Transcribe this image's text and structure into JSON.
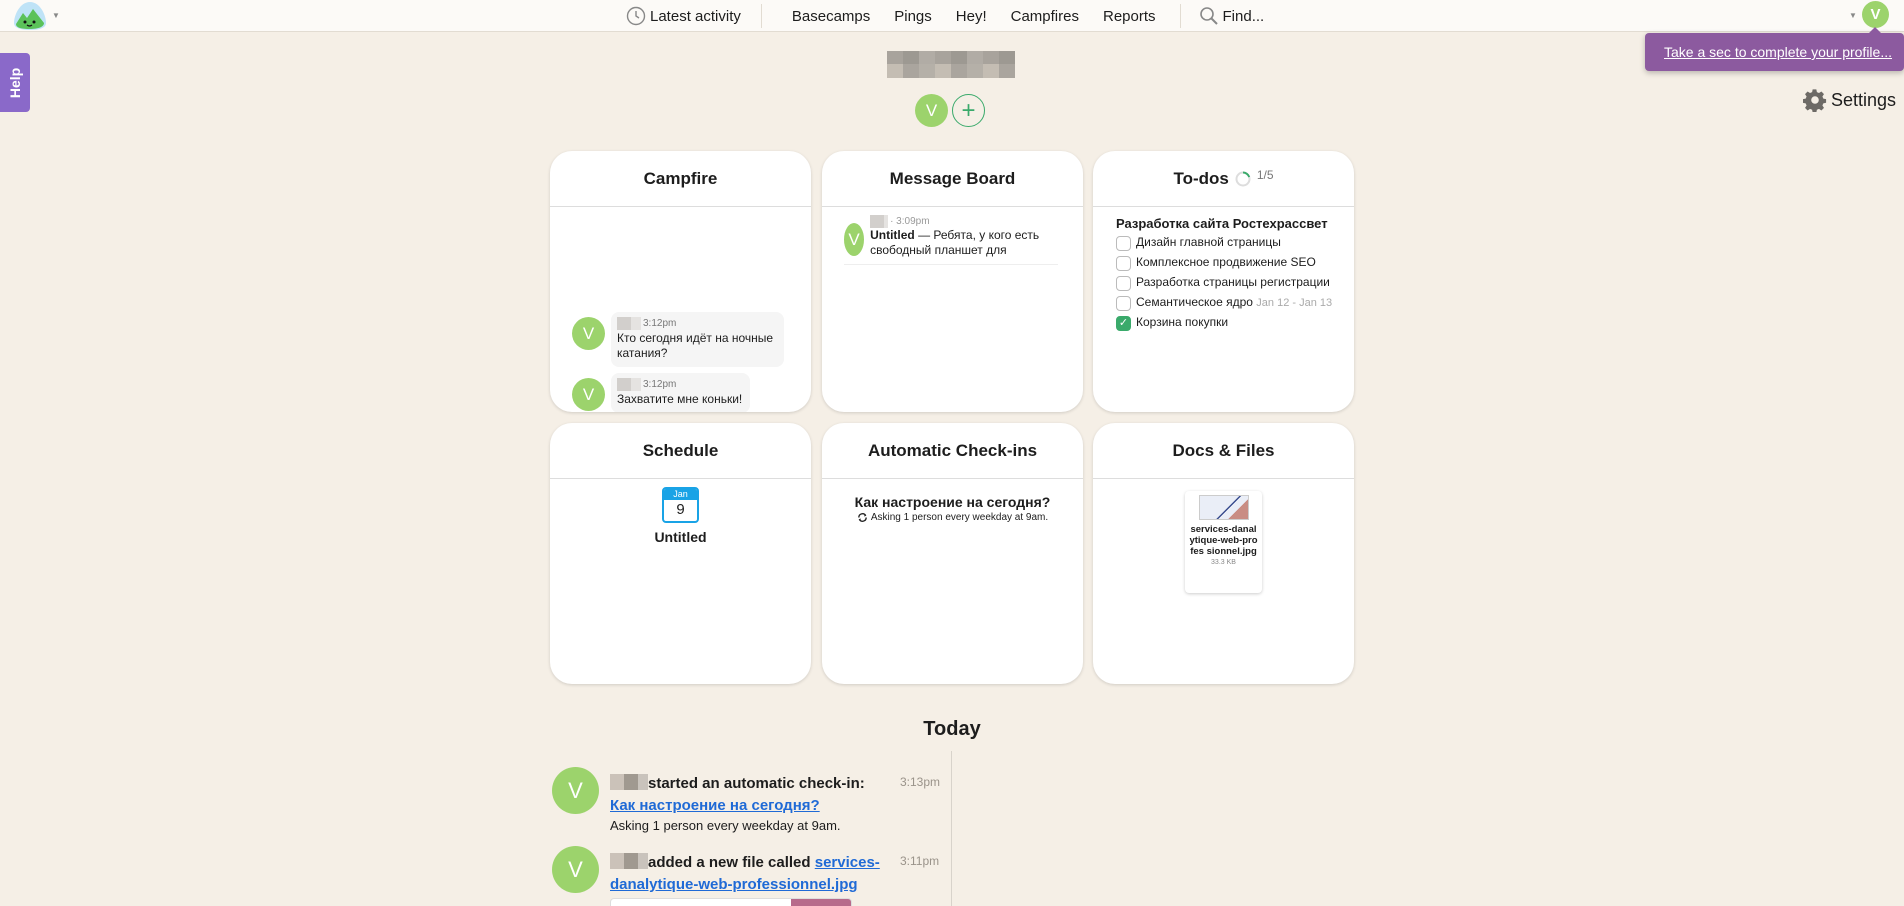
{
  "nav": {
    "latest_activity": "Latest activity",
    "items": [
      "Basecamps",
      "Pings",
      "Hey!",
      "Campfires",
      "Reports"
    ],
    "find": "Find...",
    "me_initial": "V"
  },
  "profile_prompt": "Take a sec to complete your profile...",
  "settings_label": "Settings",
  "help_label": "Help",
  "project": {
    "title": "[redacted]",
    "people": [
      {
        "initial": "V"
      }
    ],
    "add_person_symbol": "+"
  },
  "cards": {
    "campfire": {
      "title": "Campfire",
      "lines": [
        {
          "initial": "V",
          "time": "3:12pm",
          "text": "Кто сегодня идёт на ночные катания?"
        },
        {
          "initial": "V",
          "time": "3:12pm",
          "text": "Захватите мне коньки!"
        }
      ]
    },
    "message_board": {
      "title": "Message Board",
      "messages": [
        {
          "initial": "V",
          "time": "· 3:09pm",
          "subject": "Untitled",
          "excerpt": " — Ребята, у кого есть свободный планшет для"
        }
      ]
    },
    "todos": {
      "title": "To-dos",
      "count": "1/5",
      "completed_fraction": 0.2,
      "list_title": "Разработка сайта Ростехрассвет",
      "items": [
        {
          "text": "Дизайн главной страницы",
          "done": false,
          "date": ""
        },
        {
          "text": "Комплексное продвижение SEO",
          "done": false,
          "date": ""
        },
        {
          "text": "Разработка страницы регистрации",
          "done": false,
          "date": ""
        },
        {
          "text": "Семантическое ядро",
          "done": false,
          "date": "Jan 12 - Jan 13"
        },
        {
          "text": "Корзина покупки",
          "done": true,
          "date": ""
        }
      ]
    },
    "schedule": {
      "title": "Schedule",
      "month": "Jan",
      "day": "9",
      "event": "Untitled"
    },
    "checkins": {
      "title": "Automatic Check-ins",
      "question": "Как настроение на сегодня?",
      "schedule": "Asking 1 person every weekday at 9am."
    },
    "docs": {
      "title": "Docs & Files",
      "file_name": "services-danalytique-web-profes sionnel.jpg",
      "file_size": "33.3 KB"
    }
  },
  "today": {
    "heading": "Today",
    "activities": [
      {
        "initial": "V",
        "action": "started an automatic check-in: ",
        "link": "Как настроение на сегодня?",
        "sub": "Asking 1 person every weekday at 9am.",
        "time": "3:13pm"
      },
      {
        "initial": "V",
        "action": "added a new file called ",
        "link": "services-danalytique-web-professionnel.jpg",
        "sub": "",
        "time": "3:11pm"
      }
    ]
  }
}
